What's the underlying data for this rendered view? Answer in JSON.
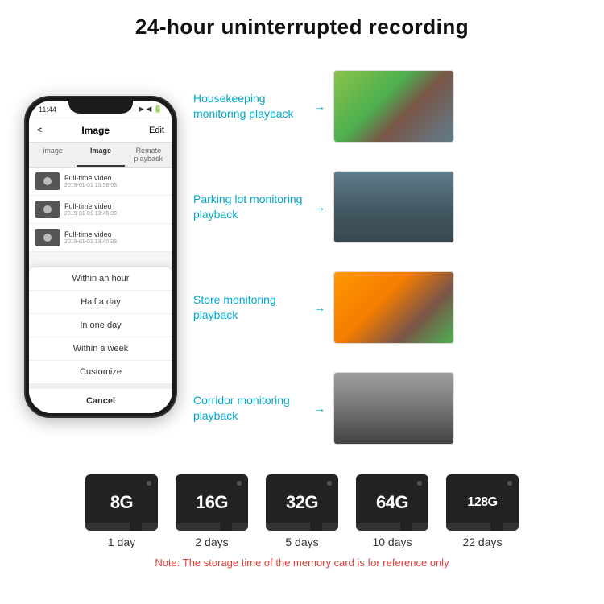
{
  "header": {
    "title": "24-hour uninterrupted recording"
  },
  "phone": {
    "status_time": "11:44",
    "nav_back": "<",
    "nav_title": "Image",
    "nav_edit": "Edit",
    "tabs": [
      "image",
      "Image",
      "Remote playback"
    ],
    "list_items": [
      {
        "title": "Full-time video",
        "date": "2019-01-01 15:58:08"
      },
      {
        "title": "Full-time video",
        "date": "2019-01-01 13:45:08"
      },
      {
        "title": "Full-time video",
        "date": "2019-01-01 13:40:08"
      }
    ],
    "dropdown_items": [
      "Within an hour",
      "Half a day",
      "In one day",
      "Within a week",
      "Customize"
    ],
    "dropdown_cancel": "Cancel"
  },
  "monitoring": {
    "panels": [
      {
        "label": "Housekeeping monitoring playback",
        "img_type": "housekeeping"
      },
      {
        "label": "Parking lot monitoring playback",
        "img_type": "parking"
      },
      {
        "label": "Store monitoring playback",
        "img_type": "store"
      },
      {
        "label": "Corridor monitoring playback",
        "img_type": "corridor"
      }
    ]
  },
  "sd_cards": [
    {
      "size": "8G",
      "days": "1 day"
    },
    {
      "size": "16G",
      "days": "2 days"
    },
    {
      "size": "32G",
      "days": "5 days"
    },
    {
      "size": "64G",
      "days": "10 days"
    },
    {
      "size": "128G",
      "days": "22 days"
    }
  ],
  "note": "Note: The storage time of the memory card is for reference only",
  "colors": {
    "accent": "#00aacc",
    "note_color": "#e53935"
  }
}
